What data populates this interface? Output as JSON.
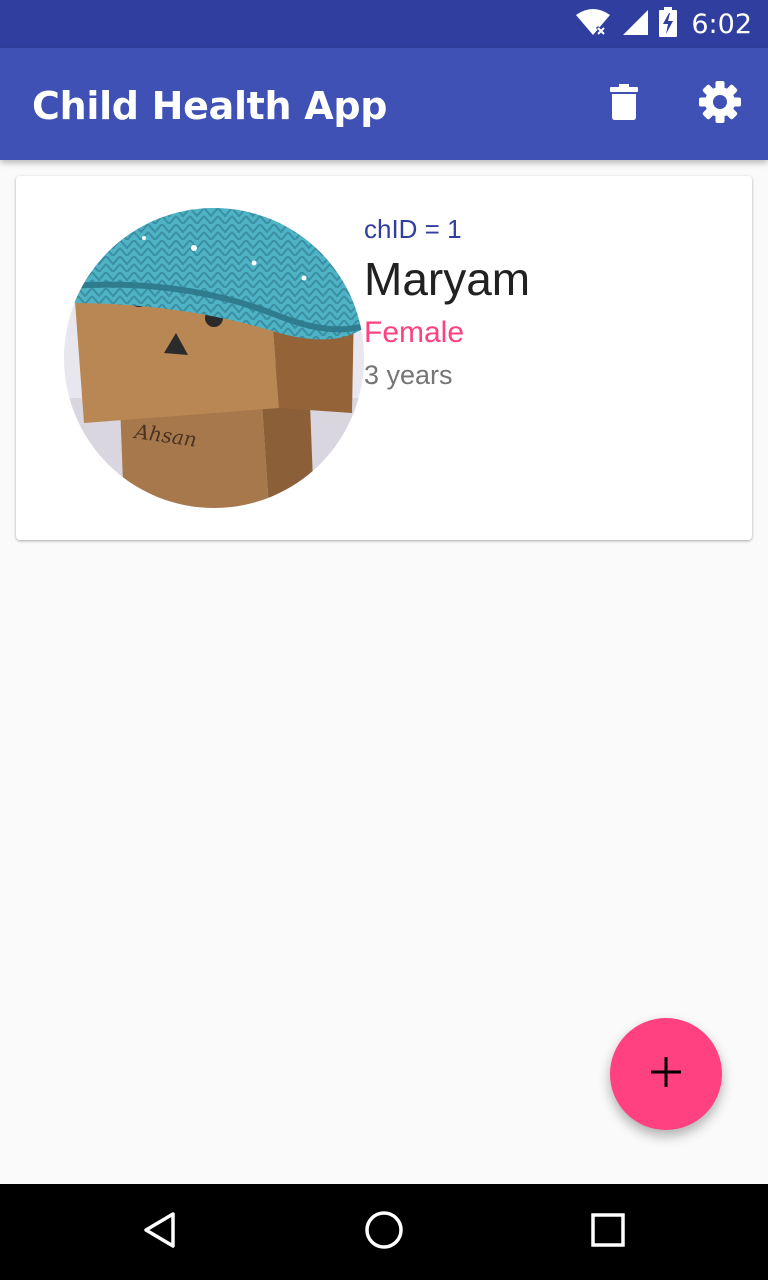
{
  "status_bar": {
    "time": "6:02",
    "icons": [
      "wifi-no-internet-icon",
      "cell-signal-icon",
      "battery-charging-icon"
    ]
  },
  "app_bar": {
    "title": "Child Health App",
    "actions": [
      "delete-icon",
      "settings-icon"
    ]
  },
  "children": [
    {
      "id_label": "chID = 1",
      "name": "Maryam",
      "gender": "Female",
      "age": "3 years",
      "photo_caption": "Ahsan"
    }
  ],
  "fab": {
    "icon": "add-icon"
  },
  "nav": {
    "icons": [
      "back-icon",
      "home-icon",
      "recents-icon"
    ]
  },
  "colors": {
    "primary_dark": "#303f9f",
    "primary": "#3f51b5",
    "accent": "#ff4081",
    "background": "#fafafa"
  }
}
